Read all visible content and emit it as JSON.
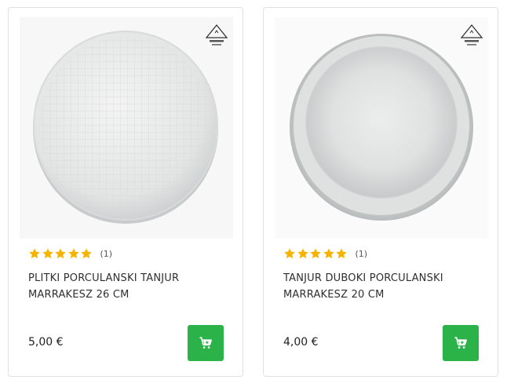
{
  "colors": {
    "accent_green": "#2bb34a",
    "star_gold": "#f5b400",
    "border": "#e1e1e1"
  },
  "products": [
    {
      "image_alt": "flat porcelain plate",
      "brand_logo_icon": "brand-logo-icon",
      "rating": 5,
      "review_count": "(1)",
      "title": "PLITKI PORCULANSKI TANJUR MARRAKESZ 26 CM",
      "price": "5,00 €",
      "cart_icon": "cart-plus-icon"
    },
    {
      "image_alt": "deep porcelain plate",
      "brand_logo_icon": "brand-logo-icon",
      "rating": 5,
      "review_count": "(1)",
      "title": "TANJUR DUBOKI PORCULANSKI MARRAKESZ 20 CM",
      "price": "4,00 €",
      "cart_icon": "cart-plus-icon"
    }
  ]
}
